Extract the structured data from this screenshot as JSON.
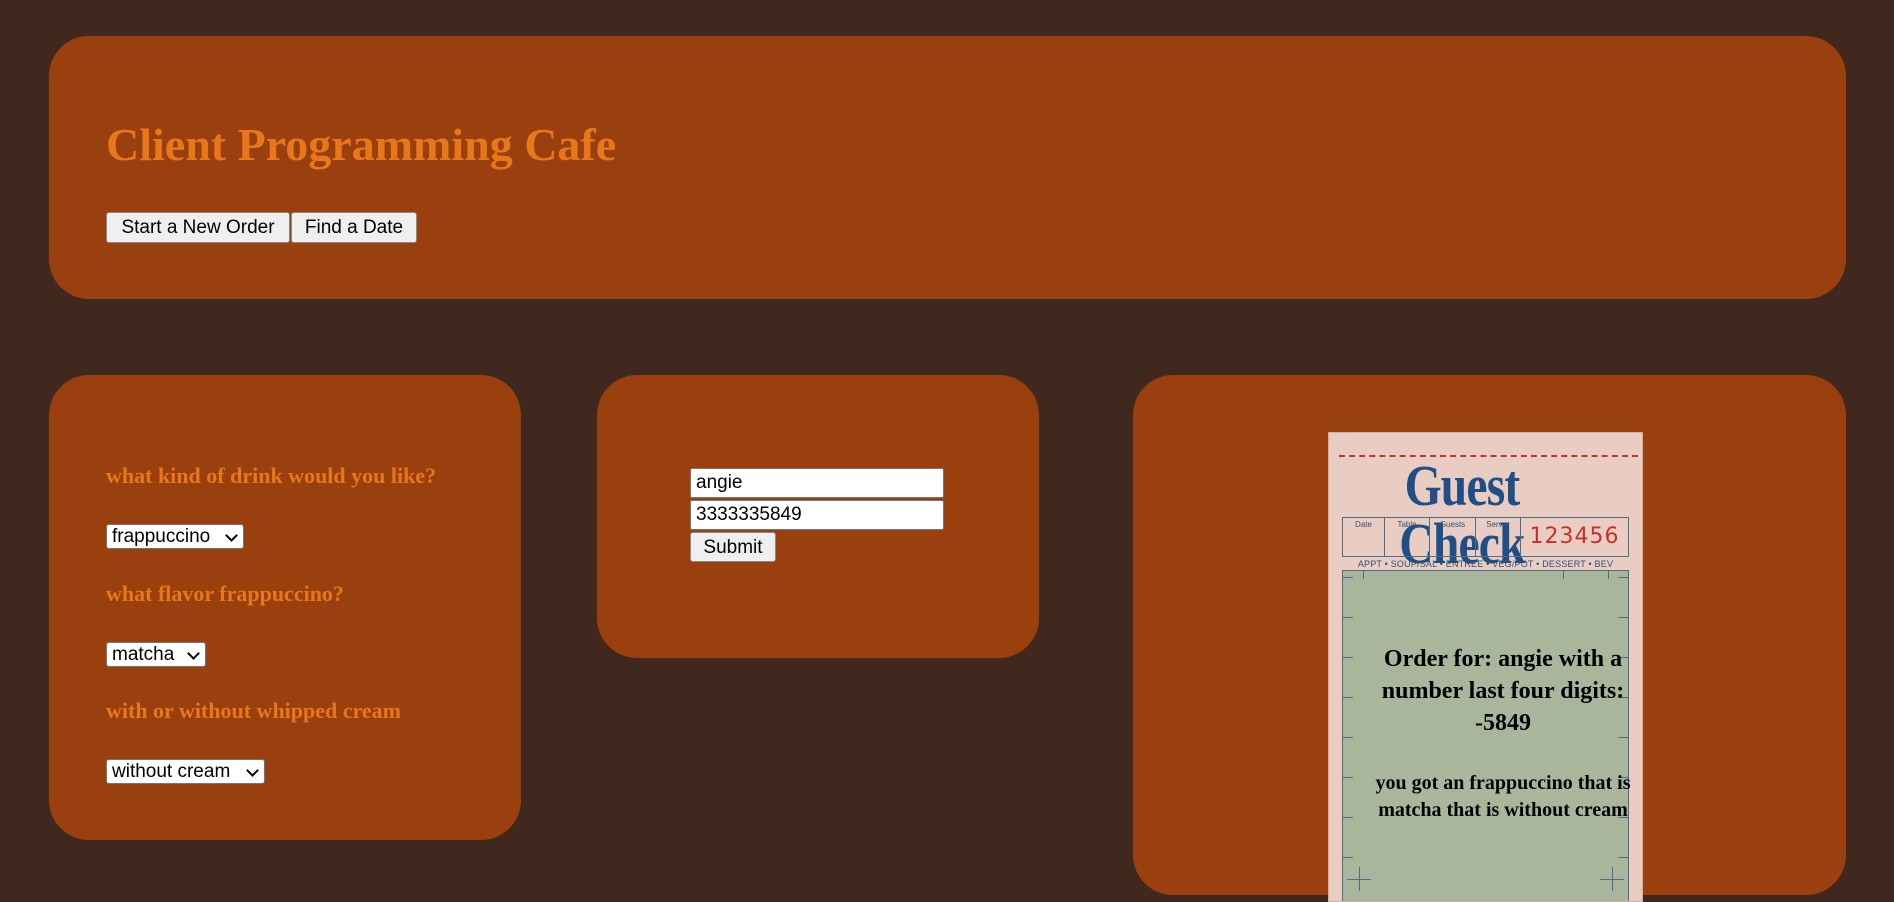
{
  "header": {
    "title": "Client Programming Cafe",
    "buttons": {
      "new_order": "Start a New Order",
      "find_date": "Find a Date"
    }
  },
  "drink_form": {
    "drink_question": "what kind of drink would you like?",
    "drink_selected": "frappuccino",
    "flavor_question": "what flavor frappuccino?",
    "flavor_selected": "matcha",
    "cream_question": "with or without whipped cream",
    "cream_selected": "without cream"
  },
  "customer_form": {
    "name_value": "angie",
    "phone_value": "3333335849",
    "submit_label": "Submit"
  },
  "guest_check": {
    "logo_text": "Guest Check",
    "columns": [
      "Date",
      "Table",
      "Guests",
      "Server"
    ],
    "check_number": "123456",
    "categories": "APPT • SOUP/SAL • ENTREE • VEG/POT • DESSERT • BEV",
    "order_for": "Order for: angie with a number last four digits: -5849",
    "order_summary": "you got an frappuccino that is matcha that is without cream"
  },
  "colors": {
    "page_background": "#41281e",
    "panel_background": "#9a400f",
    "accent_text": "#e8761b",
    "check_paper": "#e9cdc2",
    "check_body": "#a9b69c",
    "check_blue": "#1f4f86",
    "check_red": "#c8302a"
  }
}
